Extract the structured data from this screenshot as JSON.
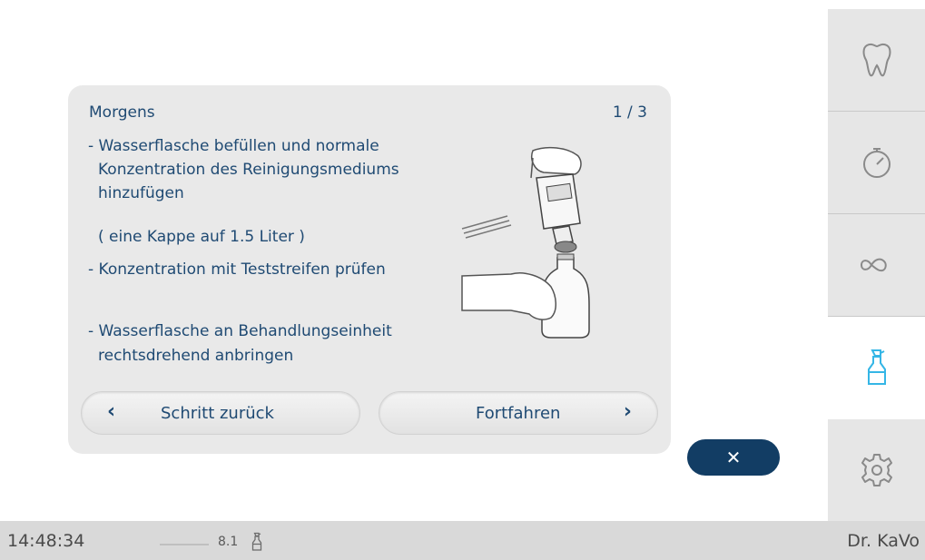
{
  "sidebar": {
    "items": [
      {
        "icon": "tooth-icon",
        "active": false
      },
      {
        "icon": "stopwatch-icon",
        "active": false
      },
      {
        "icon": "infinity-icon",
        "active": false
      },
      {
        "icon": "spray-bottle-icon",
        "active": true
      },
      {
        "icon": "gear-icon",
        "active": false
      }
    ],
    "active_color": "#35b6e6",
    "icon_color": "#8a8a8a"
  },
  "dialog": {
    "title": "Morgens",
    "step": "1 / 3",
    "lines": {
      "l1": "- Wasserflasche befüllen und normale",
      "l2": "Konzentration des Reinigungsmediums",
      "l3": "hinzufügen",
      "l4": "( eine Kappe auf 1.5 Liter )",
      "l5": "- Konzentration mit Teststreifen prüfen",
      "l6": "- Wasserflasche an Behandlungseinheit",
      "l7": "rechtsdrehend anbringen"
    },
    "back_label": "Schritt zurück",
    "next_label": "Fortfahren",
    "back_chevron": "‹",
    "next_chevron": "›",
    "close_symbol": "✕"
  },
  "statusbar": {
    "time": "14:48:34",
    "version": "8.1",
    "user": "Dr. KaVo"
  },
  "colors": {
    "text_blue": "#1f4a73",
    "close_bg": "#123d64"
  }
}
